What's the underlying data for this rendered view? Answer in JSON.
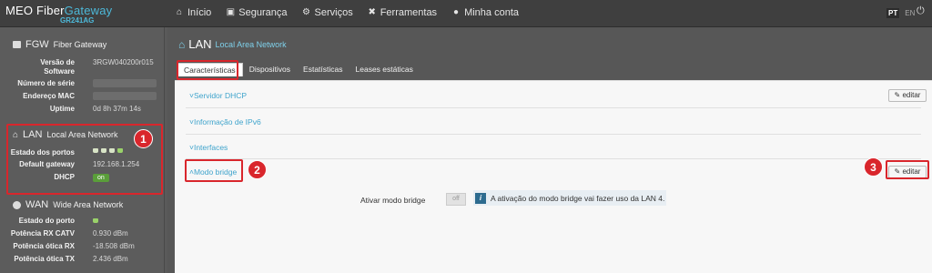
{
  "header": {
    "logo_meo": "MEO",
    "logo_fiber": " Fiber",
    "logo_gateway": "Gateway",
    "model": "GR241AG",
    "nav": [
      {
        "icon": "home-icon",
        "glyph": "⌂",
        "label": "Início"
      },
      {
        "icon": "lock-icon",
        "glyph": "🔒",
        "label": "Segurança"
      },
      {
        "icon": "gears-icon",
        "glyph": "⚙",
        "label": "Serviços"
      },
      {
        "icon": "tools-icon",
        "glyph": "✖",
        "label": "Ferramentas"
      },
      {
        "icon": "user-icon",
        "glyph": "👤",
        "label": "Minha conta"
      }
    ],
    "lang_pt": "PT",
    "lang_en": "EN",
    "power_glyph": "⏻"
  },
  "sidebar": {
    "fgw": {
      "title": "FGW",
      "subtitle": "Fiber Gateway",
      "rows": [
        {
          "k": "Versão de",
          "v": "3RGW040200r015"
        },
        {
          "k": "Software",
          "v": ""
        },
        {
          "k": "Número de série",
          "v": ""
        },
        {
          "k": "Endereço MAC",
          "v": ""
        },
        {
          "k": "Uptime",
          "v": "0d 8h 37m 14s"
        }
      ]
    },
    "lan": {
      "title": "LAN",
      "subtitle": "Local Area Network",
      "ports_label": "Estado dos portos",
      "gateway_label": "Default gateway",
      "gateway_value": "192.168.1.254",
      "dhcp_label": "DHCP",
      "dhcp_value": "on"
    },
    "wan": {
      "title": "WAN",
      "subtitle": "Wide Area Network",
      "rows": [
        {
          "k": "Estado do porto",
          "v": ""
        },
        {
          "k": "Potência RX CATV",
          "v": "0.930 dBm"
        },
        {
          "k": "Potência ótica RX",
          "v": "-18.508 dBm"
        },
        {
          "k": "Potência ótica TX",
          "v": "2.436 dBm"
        }
      ]
    }
  },
  "main": {
    "title": "LAN",
    "subtitle": "Local Area Network",
    "tabs": [
      "Características",
      "Dispositivos",
      "Estatísticas",
      "Leases estáticas"
    ],
    "sections": [
      {
        "label": "Servidor DHCP"
      },
      {
        "label": "Informação de IPv6"
      },
      {
        "label": "Interfaces"
      },
      {
        "label": "Modo bridge"
      }
    ],
    "edit_label": "editar",
    "bridge_label": "Ativar modo bridge",
    "toggle_value": "off",
    "info_text": "A ativação do modo bridge vai fazer uso da LAN 4."
  },
  "annotations": [
    "1",
    "2",
    "3"
  ],
  "colors": {
    "highlight": "#d9262c",
    "accent": "#3fa4cc",
    "on_green": "#5a9e3a"
  }
}
